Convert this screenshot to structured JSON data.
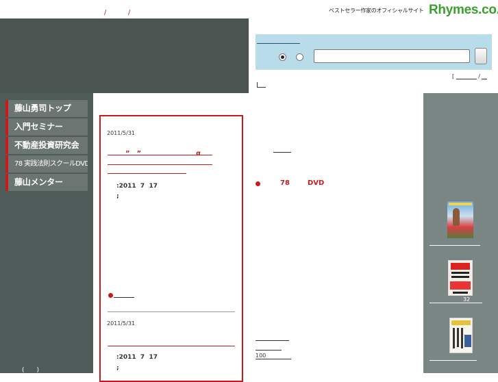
{
  "header": {
    "tagline": "ベストセラー作家のオフィシャルサイト",
    "logo": "Rhymes.co.jp",
    "slash": "/"
  },
  "search": {
    "radio_selected": true,
    "input_value": "",
    "util_slash": "/",
    "util_bracket": "["
  },
  "nav": {
    "items": [
      {
        "label": "藤山勇司トップ"
      },
      {
        "label": "入門セミナー"
      },
      {
        "label": "不動産投資研究会"
      },
      {
        "label": "78 実践法則スクールDVD"
      },
      {
        "label": "藤山メンター"
      }
    ]
  },
  "footer": {
    "paren": "(　　)"
  },
  "posts": [
    {
      "date": "2011/5/31",
      "title": "”　”　　　　　　　　α",
      "meta_date": ":2011  7  17",
      "meta_extra": ";"
    },
    {
      "date": "2011/5/31",
      "meta_date": ":2011  7  17",
      "meta_extra": ";"
    }
  ],
  "promo": {
    "number": "78",
    "label": "DVD"
  },
  "counts": {
    "hundred": "100"
  },
  "books": [
    {
      "caption": ""
    },
    {
      "caption": "32"
    },
    {
      "caption": ""
    }
  ],
  "colors": {
    "accent": "#c81a1a",
    "dark": "#4a5552",
    "search_bg": "#b8dcea",
    "logo": "#3aa12f",
    "right_col": "#7a8683"
  }
}
